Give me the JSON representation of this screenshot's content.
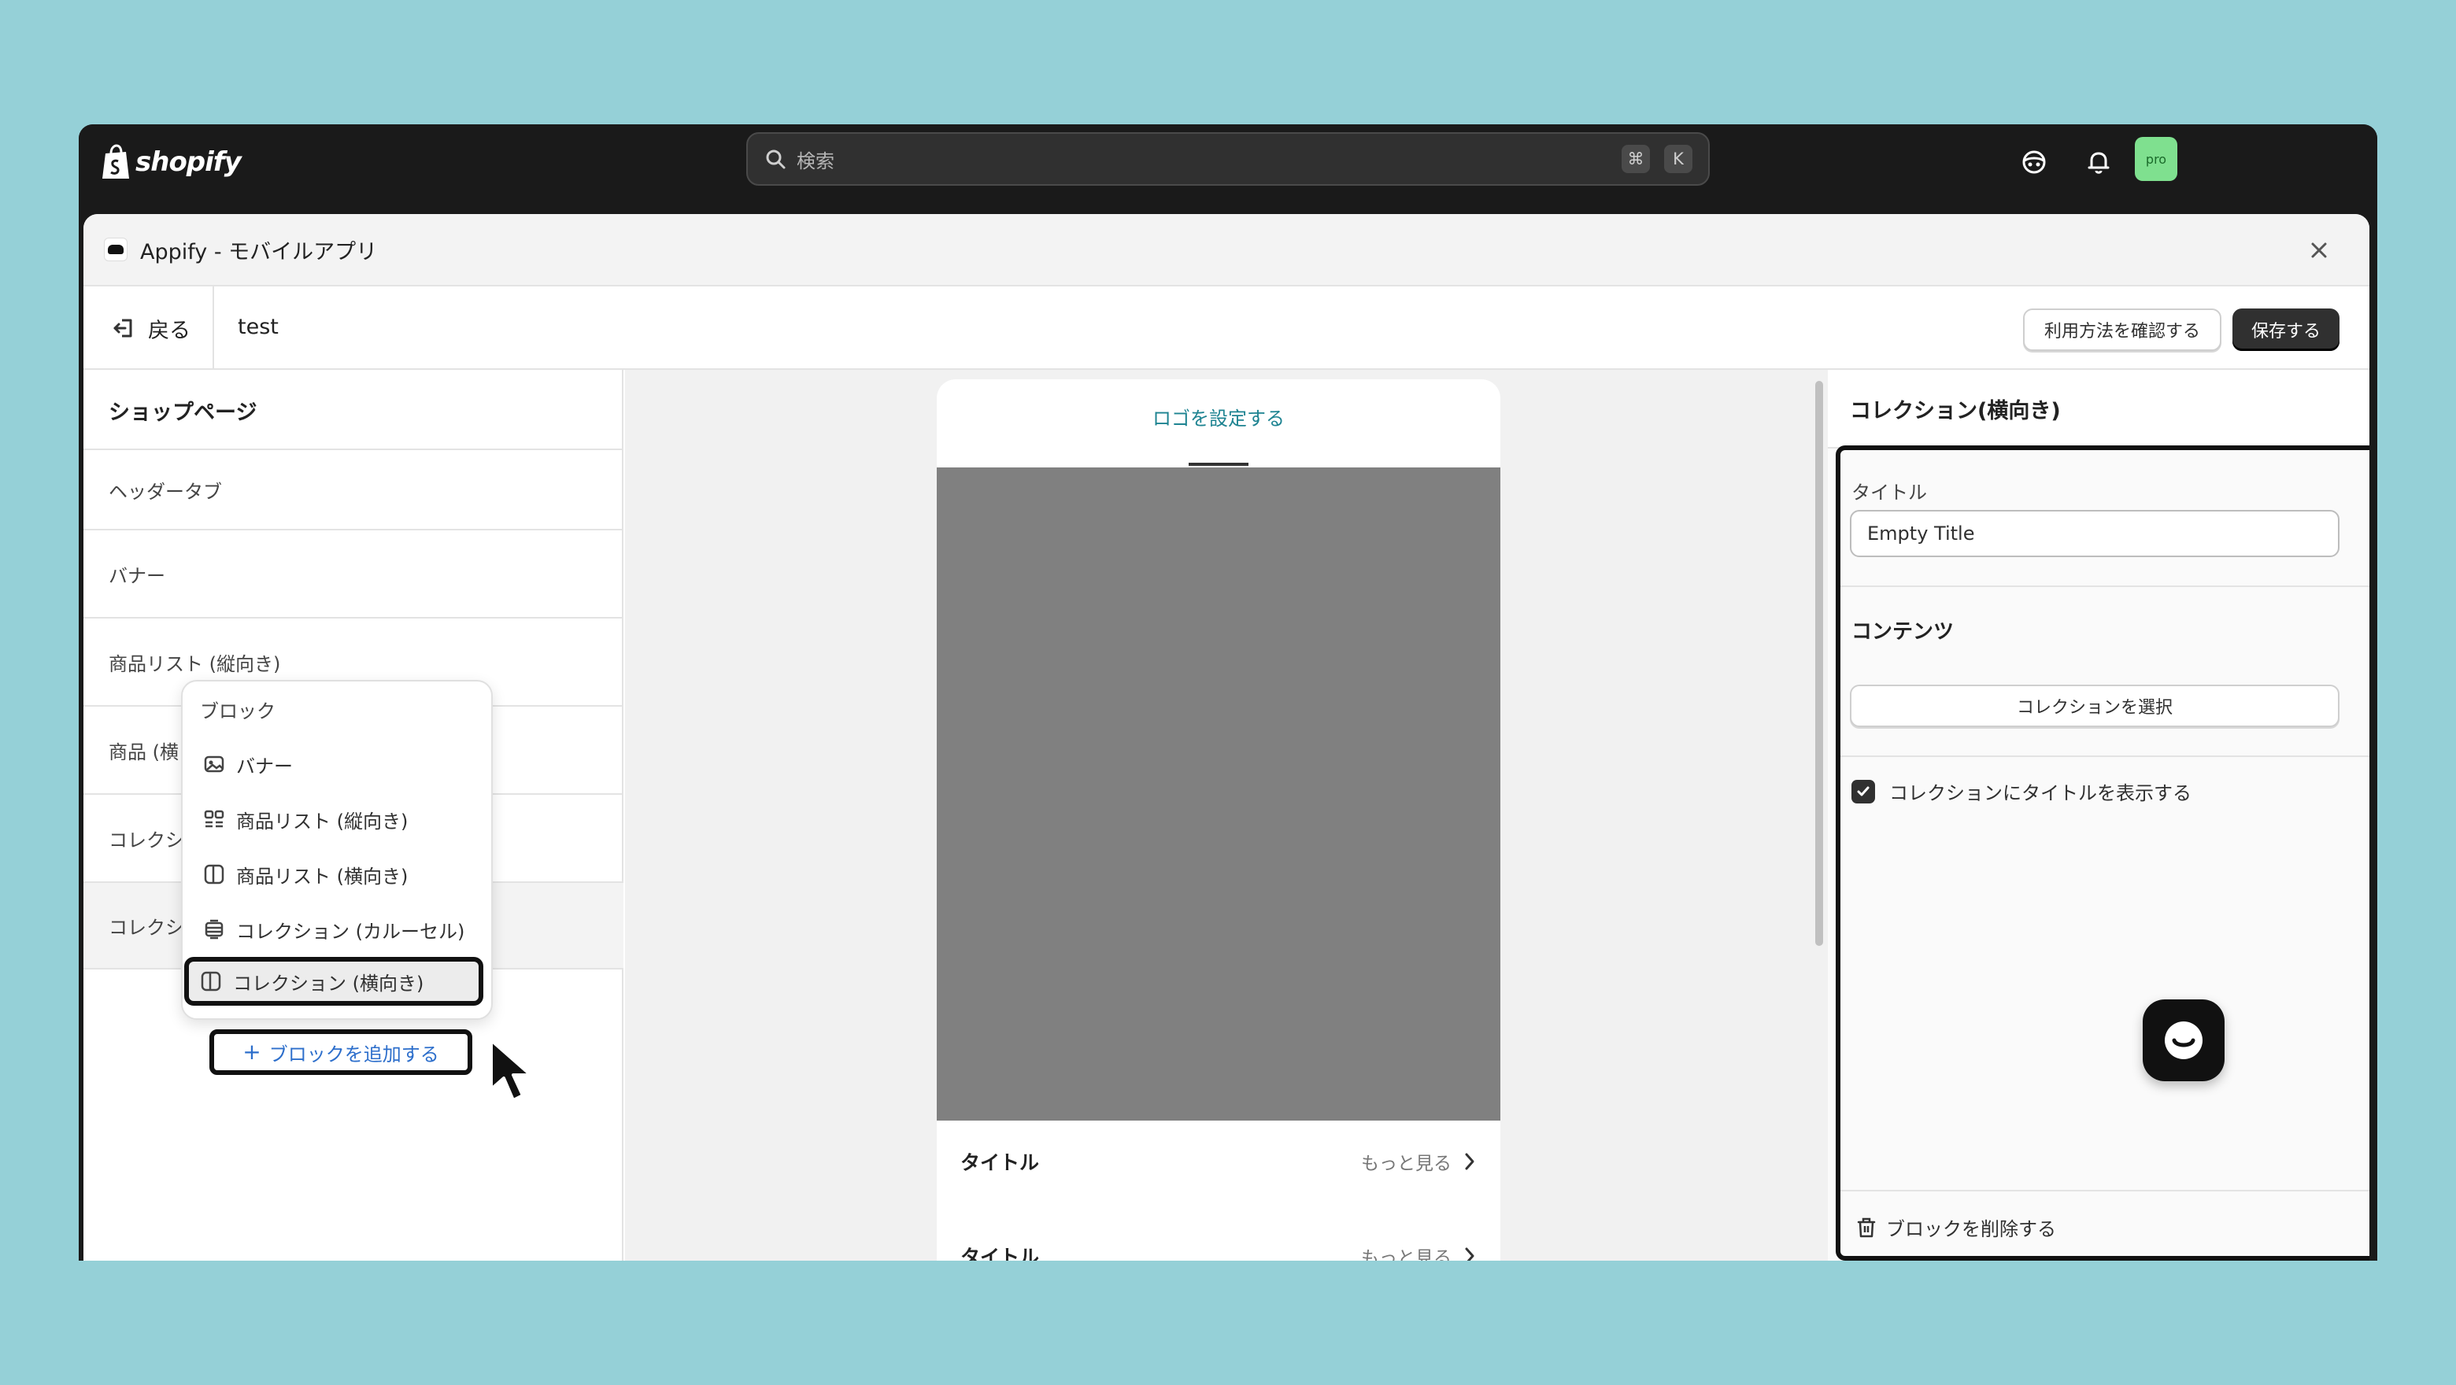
{
  "topbar": {
    "brand": "shopify",
    "search_placeholder": "検索",
    "shortcut_keys": [
      "⌘",
      "K"
    ],
    "avatar_label": "pro",
    "colors": {
      "topbar_bg": "#1a1a1a",
      "avatar_bg": "#7fe08f"
    }
  },
  "modal": {
    "title": "Appify - モバイルアプリ",
    "back_label": "戻る",
    "document_name": "test",
    "help_button": "利用方法を確認する",
    "save_button": "保存する"
  },
  "left_panel": {
    "title": "ショップページ",
    "items": [
      {
        "label": "ヘッダータブ"
      },
      {
        "label": "バナー"
      },
      {
        "label": "商品リスト (縦向き)"
      },
      {
        "label": "商品 (横"
      },
      {
        "label": "コレクシ"
      },
      {
        "label": "コレクシ"
      }
    ],
    "popover": {
      "title": "ブロック",
      "items": [
        {
          "label": "バナー",
          "icon": "banner-icon"
        },
        {
          "label": "商品リスト (縦向き)",
          "icon": "grid-icon"
        },
        {
          "label": "商品リスト (横向き)",
          "icon": "columns-icon"
        },
        {
          "label": "コレクション (カルーセル)",
          "icon": "carousel-icon"
        },
        {
          "label": "コレクション (横向き)",
          "icon": "columns-icon",
          "highlighted": true
        }
      ]
    },
    "add_block_button": "ブロックを追加する"
  },
  "preview": {
    "logo_link": "ロゴを設定する",
    "rows": [
      {
        "title": "タイトル",
        "more": "もっと見る"
      },
      {
        "title": "タイトル",
        "more": "もっと見る"
      }
    ]
  },
  "right_panel": {
    "title": "コレクション(横向き)",
    "title_label": "タイトル",
    "title_value": "Empty Title",
    "content_heading": "コンテンツ",
    "select_collection_button": "コレクションを選択",
    "show_title_checkbox": "コレクションにタイトルを表示する",
    "show_title_checked": true,
    "delete_block": "ブロックを削除する"
  }
}
